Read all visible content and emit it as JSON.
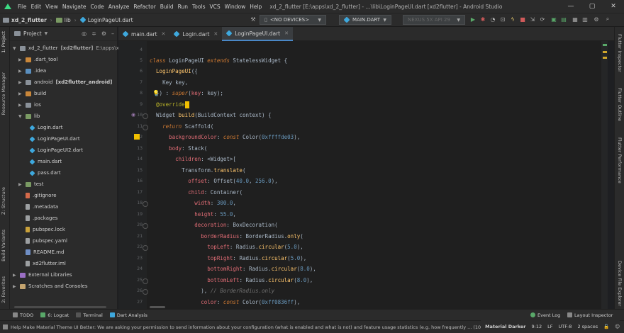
{
  "window": {
    "menu": [
      "File",
      "Edit",
      "View",
      "Navigate",
      "Code",
      "Analyze",
      "Refactor",
      "Build",
      "Run",
      "Tools",
      "VCS",
      "Window",
      "Help"
    ],
    "title": "xd_2_flutter [E:\\apps\\xd_2_flutter] - ...\\lib\\LoginPageUI.dart [xd2flutter] - Android Studio",
    "controls": [
      "—",
      "▢",
      "✕"
    ]
  },
  "navbar": {
    "crumbs": [
      "xd_2_flutter",
      "lib",
      "LoginPageUI.dart"
    ],
    "device": "<NO DEVICES>",
    "run_config": "MAIN.DART",
    "avd": "NEXUS 5X API 29"
  },
  "project": {
    "header": "Project",
    "root": "xd_2_flutter",
    "root_module": "[xd2flutter]",
    "root_path": "E:\\apps\\xd_2_fl",
    "items": [
      {
        "label": ".dart_tool",
        "sub": ""
      },
      {
        "label": ".idea",
        "sub": ""
      },
      {
        "label": "android",
        "sub": "[xd2flutter_android]"
      },
      {
        "label": "build",
        "sub": ""
      },
      {
        "label": "ios",
        "sub": ""
      },
      {
        "label": "lib",
        "sub": ""
      },
      {
        "label": "Login.dart",
        "sub": ""
      },
      {
        "label": "LoginPageUI.dart",
        "sub": ""
      },
      {
        "label": "LoginPageUI2.dart",
        "sub": ""
      },
      {
        "label": "main.dart",
        "sub": ""
      },
      {
        "label": "pass.dart",
        "sub": ""
      },
      {
        "label": "test",
        "sub": ""
      },
      {
        "label": ".gitignore",
        "sub": ""
      },
      {
        "label": ".metadata",
        "sub": ""
      },
      {
        "label": ".packages",
        "sub": ""
      },
      {
        "label": "pubspec.lock",
        "sub": ""
      },
      {
        "label": "pubspec.yaml",
        "sub": ""
      },
      {
        "label": "README.md",
        "sub": ""
      },
      {
        "label": "xd2flutter.iml",
        "sub": ""
      },
      {
        "label": "External Libraries",
        "sub": ""
      },
      {
        "label": "Scratches and Consoles",
        "sub": ""
      }
    ]
  },
  "tabs": [
    "main.dart",
    "Login.dart",
    "LoginPageUI.dart"
  ],
  "left_tools": [
    "1: Project",
    "Resource Manager",
    "Z: Structure",
    "Build Variants",
    "2: Favorites"
  ],
  "right_tools": [
    "Flutter Inspector",
    "Flutter Outline",
    "Flutter Performance",
    "Device File Explorer"
  ],
  "editor": {
    "line_numbers": [
      "4",
      "5",
      "6",
      "7",
      "8",
      "9",
      "10",
      "11",
      "12",
      "13",
      "14",
      "15",
      "16",
      "17",
      "18",
      "19",
      "20",
      "21",
      "22",
      "23",
      "24",
      "25",
      "26",
      "27"
    ]
  },
  "bottom_tools": [
    "TODO",
    "6: Logcat",
    "Terminal",
    "Dart Analysis"
  ],
  "bottom_right_tools": [
    "Event Log",
    "Layout Inspector"
  ],
  "status": {
    "message": "Help Make Material Theme UI Better: We are asking your permission to send information about your configuration (what is enabled and what is not) and feature usage statistics (e.g. how frequently ... (10 minutes ago)",
    "theme": "Material Darker",
    "position": "9:12",
    "line_sep": "LF",
    "encoding": "UTF-8",
    "indent": "2 spaces"
  }
}
